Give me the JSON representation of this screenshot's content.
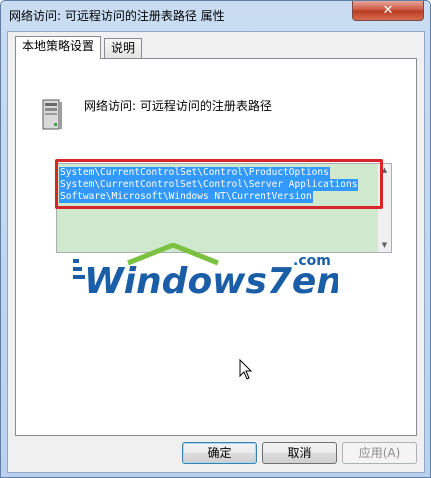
{
  "window": {
    "title": "网络访问: 可远程访问的注册表路径 属性",
    "close_glyph": "✕"
  },
  "tabs": [
    {
      "label": "本地策略设置",
      "active": true
    },
    {
      "label": "说明",
      "active": false
    }
  ],
  "policy": {
    "icon": "server-icon",
    "name": "网络访问: 可远程访问的注册表路径"
  },
  "registry_paths": {
    "lines": [
      "System\\CurrentControlSet\\Control\\ProductOptions",
      "System\\CurrentControlSet\\Control\\Server Applications",
      "Software\\Microsoft\\Windows NT\\CurrentVersion"
    ],
    "scroll_up_glyph": "▲",
    "scroll_down_glyph": "▼"
  },
  "watermark": {
    "main_text": "Windows7en",
    "dotcom_text": ".com"
  },
  "buttons": {
    "ok": "确定",
    "cancel": "取消",
    "apply": "应用(A)"
  },
  "colors": {
    "selection": "#3399ff",
    "highlight_box": "#d7262b",
    "textarea_bg": "#cfe9cf",
    "logo_blue": "#1a5ea8",
    "logo_green": "#7cc242"
  }
}
